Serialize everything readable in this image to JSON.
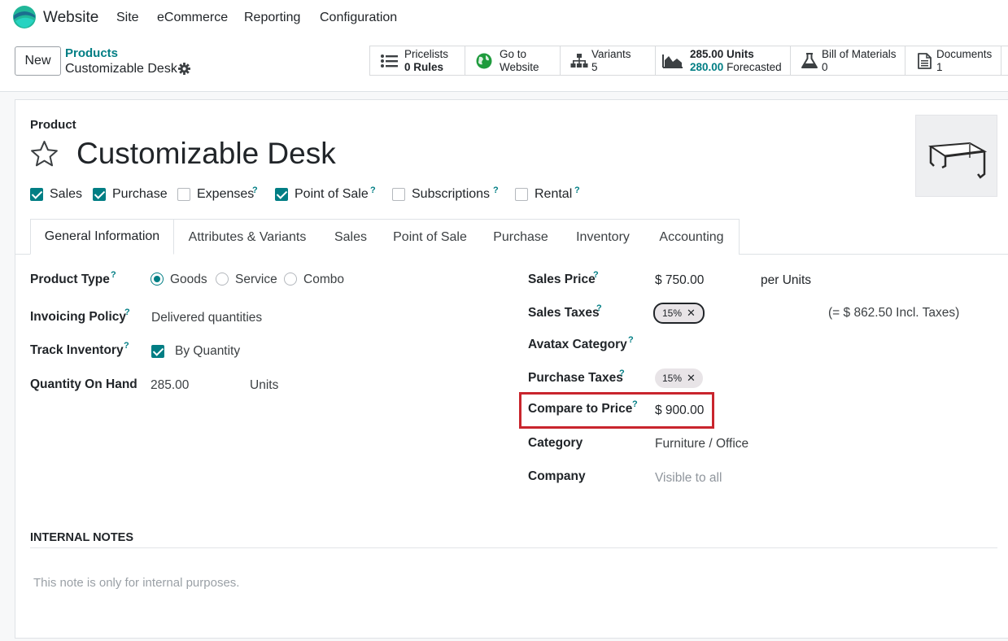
{
  "topnav": {
    "app_name": "Website",
    "menu": [
      "Site",
      "eCommerce",
      "Reporting",
      "Configuration"
    ]
  },
  "control_panel": {
    "new_label": "New",
    "breadcrumb_parent": "Products",
    "breadcrumb_current": "Customizable Desk"
  },
  "smart_buttons": {
    "pricelists": {
      "line1": "Pricelists",
      "line2_value": "0",
      "line2_label": "Rules"
    },
    "website": {
      "line1": "Go to",
      "line2": "Website"
    },
    "variants": {
      "line1": "Variants",
      "line2": "5"
    },
    "stock": {
      "on_hand": "285.00 Units",
      "forecast_value": "280.00",
      "forecast_label": "Forecasted"
    },
    "bom": {
      "line1": "Bill of Materials",
      "line2": "0"
    },
    "documents": {
      "line1": "Documents",
      "line2": "1"
    }
  },
  "product": {
    "label": "Product",
    "name": "Customizable Desk",
    "flags": [
      {
        "label": "Sales",
        "checked": true
      },
      {
        "label": "Purchase",
        "checked": true
      },
      {
        "label": "Expenses",
        "checked": false,
        "help": "?"
      },
      {
        "label": "Point of Sale",
        "checked": true,
        "help": "?"
      },
      {
        "label": "Subscriptions",
        "checked": false,
        "help": "?"
      },
      {
        "label": "Rental",
        "checked": false,
        "help": "?"
      }
    ]
  },
  "tabs": [
    "General Information",
    "Attributes & Variants",
    "Sales",
    "Point of Sale",
    "Purchase",
    "Inventory",
    "Accounting"
  ],
  "left_fields": {
    "product_type": {
      "label": "Product Type",
      "options": [
        "Goods",
        "Service",
        "Combo"
      ],
      "selected": "Goods"
    },
    "invoicing_policy": {
      "label": "Invoicing Policy",
      "value": "Delivered quantities"
    },
    "track_inventory": {
      "label": "Track Inventory",
      "value": "By Quantity"
    },
    "qty_on_hand": {
      "label": "Quantity On Hand",
      "value": "285.00",
      "uom": "Units"
    }
  },
  "right_fields": {
    "sales_price": {
      "label": "Sales Price",
      "value": "$ 750.00",
      "uom": "per Units"
    },
    "sales_taxes": {
      "label": "Sales Taxes",
      "tag": "15%",
      "incl": "(= $ 862.50 Incl. Taxes)"
    },
    "avatax": {
      "label": "Avatax Category"
    },
    "purchase_taxes": {
      "label": "Purchase Taxes",
      "tag": "15%"
    },
    "compare_price": {
      "label": "Compare to Price",
      "value": "$ 900.00"
    },
    "category": {
      "label": "Category",
      "value": "Furniture / Office"
    },
    "company": {
      "label": "Company",
      "value": "Visible to all"
    }
  },
  "notes": {
    "title": "INTERNAL NOTES",
    "placeholder": "This note is only for internal purposes."
  },
  "help_mark": "?",
  "remove_mark": "✕",
  "colors": {
    "accent": "#017e84",
    "highlight": "#c9252d",
    "brand": "#714b67"
  }
}
